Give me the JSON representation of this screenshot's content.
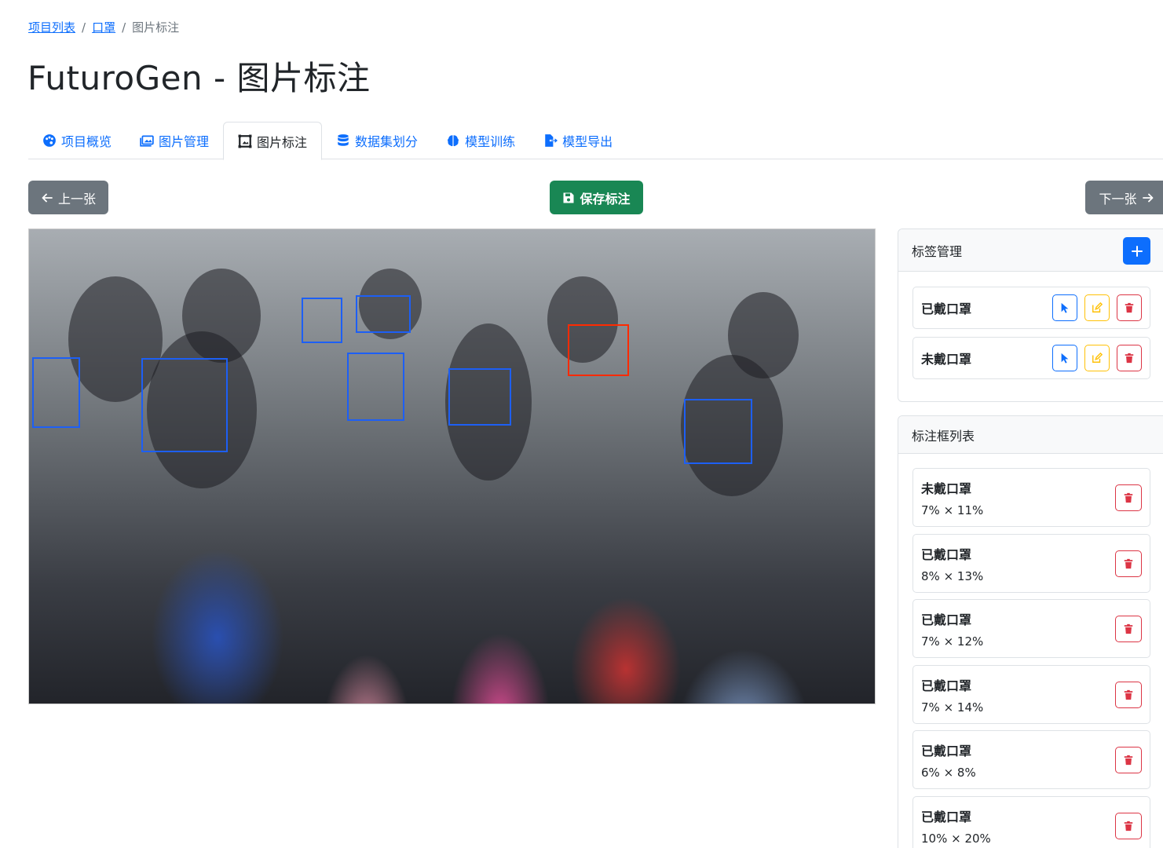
{
  "breadcrumb": {
    "items": [
      "项目列表",
      "口罩"
    ],
    "separator": "/",
    "current": "图片标注"
  },
  "page": {
    "title": "FuturoGen - 图片标注"
  },
  "tabs": [
    {
      "label": "项目概览",
      "icon": "palette-icon"
    },
    {
      "label": "图片管理",
      "icon": "images-icon"
    },
    {
      "label": "图片标注",
      "icon": "bounding-box-icon",
      "active": true
    },
    {
      "label": "数据集划分",
      "icon": "database-icon"
    },
    {
      "label": "模型训练",
      "icon": "brain-icon"
    },
    {
      "label": "模型导出",
      "icon": "file-export-icon"
    }
  ],
  "toolbar": {
    "prev_label": "上一张",
    "save_label": "保存标注",
    "next_label": "下一张"
  },
  "tag_panel": {
    "title": "标签管理",
    "tags": [
      {
        "name": "已戴口罩"
      },
      {
        "name": "未戴口罩"
      }
    ]
  },
  "box_panel": {
    "title": "标注框列表",
    "boxes": [
      {
        "label": "未戴口罩",
        "size": "7% × 11%"
      },
      {
        "label": "已戴口罩",
        "size": "8% × 13%"
      },
      {
        "label": "已戴口罩",
        "size": "7% × 12%"
      },
      {
        "label": "已戴口罩",
        "size": "7% × 14%"
      },
      {
        "label": "已戴口罩",
        "size": "6% × 8%"
      },
      {
        "label": "已戴口罩",
        "size": "10% × 20%"
      }
    ]
  },
  "colors": {
    "primary": "#0d6efd",
    "success": "#198754",
    "secondary": "#6c757d",
    "warning": "#ffc107",
    "danger": "#dc3545",
    "bbox_masked": "#1d5ff5",
    "bbox_unmasked": "#ff2a00"
  }
}
